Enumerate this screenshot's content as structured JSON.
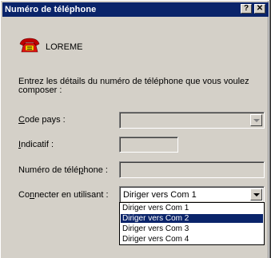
{
  "window": {
    "title": "Numéro de téléphone",
    "help_glyph": "?",
    "close_glyph": "✕"
  },
  "app": {
    "name": "LOREME",
    "icon": "telephone-icon"
  },
  "intro": "Entrez les détails du numéro de téléphone que vous voulez composer :",
  "fields": {
    "country_code": {
      "label_key": "C",
      "label_rest": "ode pays :",
      "value": "",
      "disabled": true
    },
    "area_code": {
      "label_key": "I",
      "label_rest": "ndicatif :",
      "value": ""
    },
    "phone": {
      "label_pre": "Numéro de télé",
      "label_key": "p",
      "label_post": "hone :",
      "value": ""
    },
    "connect": {
      "label_pre": "Co",
      "label_key": "n",
      "label_post": "necter en utilisant :",
      "value": "Diriger vers Com 1"
    }
  },
  "dropdown": {
    "options": [
      "Diriger vers Com 1",
      "Diriger vers Com 2",
      "Diriger vers Com 3",
      "Diriger vers Com 4"
    ],
    "highlighted_index": 1
  },
  "colors": {
    "titlebar": "#0a246a",
    "face": "#d4d0c8",
    "highlight": "#0a246a"
  }
}
